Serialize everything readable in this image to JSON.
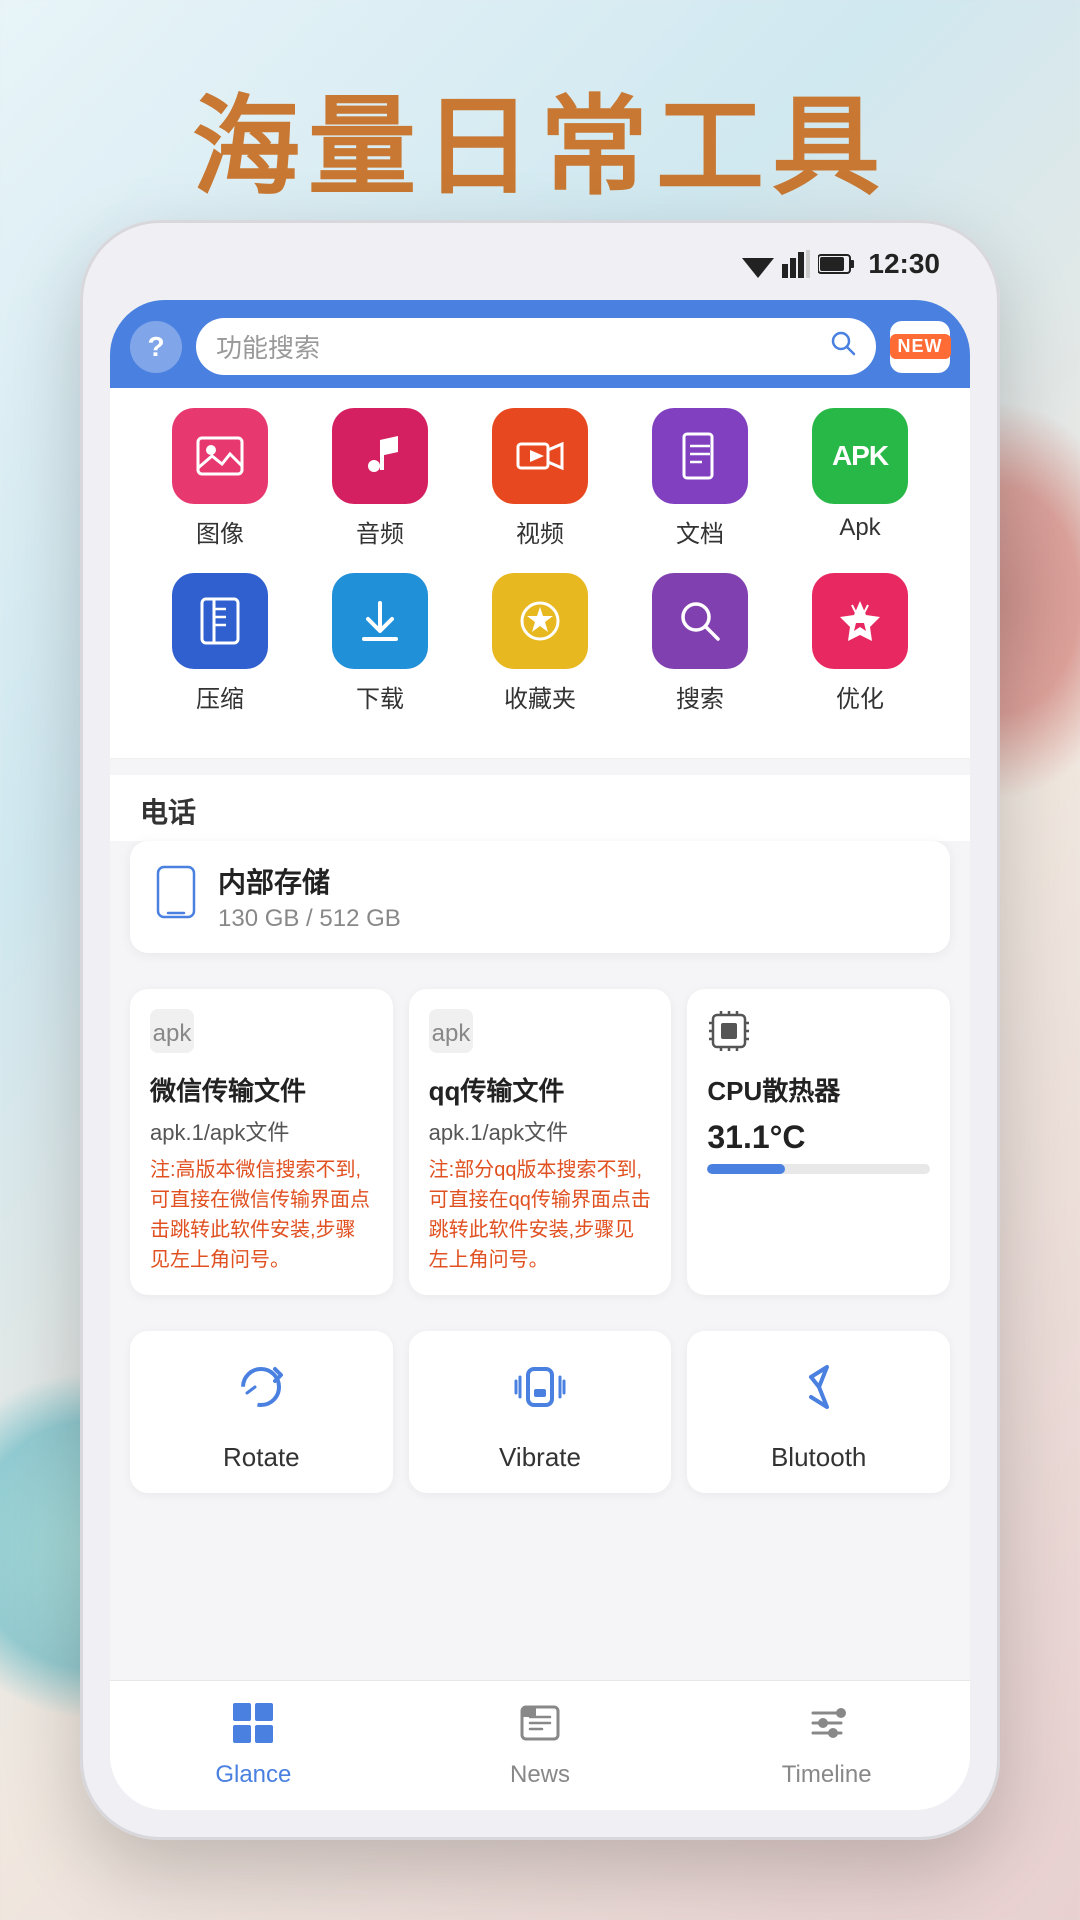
{
  "hero": {
    "title": "海量日常工具"
  },
  "statusBar": {
    "time": "12:30"
  },
  "topBar": {
    "searchPlaceholder": "功能搜索",
    "newBadge": "NEW"
  },
  "icons": {
    "row1": [
      {
        "label": "图像",
        "icon": "🖼️",
        "color": "icon-pink"
      },
      {
        "label": "音频",
        "icon": "🎵",
        "color": "icon-crimson"
      },
      {
        "label": "视频",
        "icon": "▶️",
        "color": "icon-orange"
      },
      {
        "label": "文档",
        "icon": "📄",
        "color": "icon-purple"
      },
      {
        "label": "Apk",
        "icon": "APK",
        "color": "icon-green"
      }
    ],
    "row2": [
      {
        "label": "压缩",
        "icon": "📦",
        "color": "icon-blue"
      },
      {
        "label": "下载",
        "icon": "⬇️",
        "color": "icon-cyan"
      },
      {
        "label": "收藏夹",
        "icon": "⭐",
        "color": "icon-yellow"
      },
      {
        "label": "搜索",
        "icon": "🔍",
        "color": "icon-violet"
      },
      {
        "label": "优化",
        "icon": "🚀",
        "color": "icon-redpink"
      }
    ]
  },
  "phoneSection": {
    "header": "电话",
    "storage": {
      "title": "内部存储",
      "usage": "130 GB / 512 GB"
    }
  },
  "featureCards": [
    {
      "title": "微信传输文件",
      "subtitle": "apk.1/apk文件",
      "note": "注:高版本微信搜索不到,可直接在微信传输界面点击跳转此软件安装,步骤见左上角问号。"
    },
    {
      "title": "qq传输文件",
      "subtitle": "apk.1/apk文件",
      "note": "注:部分qq版本搜索不到,可直接在qq传输界面点击跳转此软件安装,步骤见左上角问号。"
    },
    {
      "title": "CPU散热器",
      "temp": "31.1°C",
      "note": ""
    }
  ],
  "toolCards": [
    {
      "label": "Rotate",
      "icon": "rotate"
    },
    {
      "label": "Vibrate",
      "icon": "vibrate"
    },
    {
      "label": "Blutooth",
      "icon": "bluetooth"
    }
  ],
  "bottomNav": [
    {
      "label": "Glance",
      "icon": "grid",
      "active": true
    },
    {
      "label": "News",
      "icon": "news",
      "active": false
    },
    {
      "label": "Timeline",
      "icon": "timeline",
      "active": false
    }
  ]
}
